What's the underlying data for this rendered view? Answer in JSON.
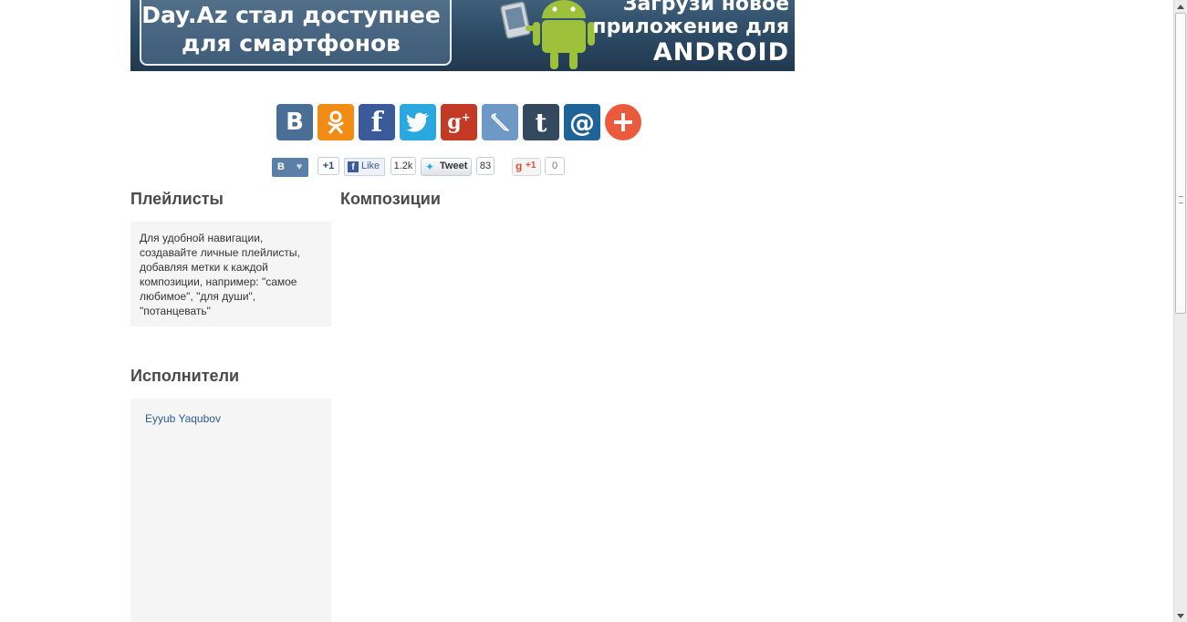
{
  "banner": {
    "left_line1": "Day.Az стал доступнее",
    "left_line2": "для смартфонов",
    "right_line1": "Загрузи новое",
    "right_line2": "приложение для",
    "right_line3": "ANDROID"
  },
  "share_buttons": [
    {
      "name": "vkontakte",
      "glyph": "B",
      "color": "#4a6f97"
    },
    {
      "name": "odnoklassniki",
      "glyph": "ok",
      "color": "#f18d16"
    },
    {
      "name": "facebook",
      "glyph": "f",
      "color": "#3b5a9a"
    },
    {
      "name": "twitter",
      "glyph": "t",
      "color": "#2aa9e0"
    },
    {
      "name": "google-plus",
      "glyph": "g+",
      "color": "#c23a24"
    },
    {
      "name": "livejournal",
      "glyph": "pencil",
      "color": "#6e98c5"
    },
    {
      "name": "tumblr",
      "glyph": "t",
      "color": "#34495e"
    },
    {
      "name": "mail",
      "glyph": "@",
      "color": "#1f6399"
    },
    {
      "name": "more",
      "glyph": "+",
      "color": "#eb5a3c"
    }
  ],
  "counters": {
    "vk_label": "B",
    "vk_count": "+1",
    "fb_label": "Like",
    "fb_count": "1.2k",
    "tw_label": "Tweet",
    "tw_count": "83",
    "gplus_label": "+1",
    "gplus_count": "0"
  },
  "playlists": {
    "title": "Плейлисты",
    "note": "Для удобной навигации, создавайте личные плейлисты, добавляя метки к каждой композиции, например: \"самое любимое\", \"для души\", \"потанцевать\""
  },
  "compositions": {
    "title": "Композиции"
  },
  "artists": {
    "title": "Исполнители",
    "items": [
      "Eyyub Yaqubov"
    ]
  },
  "colors": {
    "heading": "#4a4a4a",
    "panel_bg": "#f5f5f5",
    "link": "#2a5d96"
  }
}
